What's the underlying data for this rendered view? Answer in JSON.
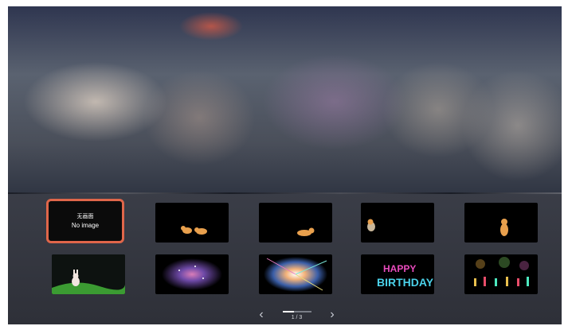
{
  "selected_tile": {
    "line1": "无画面",
    "line2": "No image"
  },
  "tiles": [
    {
      "name": "no-image-tile",
      "theme": "none"
    },
    {
      "name": "cats-pair-tile",
      "theme": "cats"
    },
    {
      "name": "cat-lying-tile",
      "theme": "cat"
    },
    {
      "name": "cat-small-tile",
      "theme": "cat"
    },
    {
      "name": "cat-sitting-tile",
      "theme": "cat"
    },
    {
      "name": "bunny-meadow-tile",
      "theme": "bunny"
    },
    {
      "name": "nebula-tile",
      "theme": "space"
    },
    {
      "name": "fireworks-tile",
      "theme": "fireworks"
    },
    {
      "name": "happy-birthday-tile",
      "theme": "birthday",
      "text": "HAPPY BIRTHDAY"
    },
    {
      "name": "birthday-candles-tile",
      "theme": "candles"
    }
  ],
  "pagination": {
    "text": "1 / 3",
    "current": 1,
    "total": 3
  },
  "colors": {
    "selection_border": "#e0664a",
    "panel": "#34363f"
  }
}
